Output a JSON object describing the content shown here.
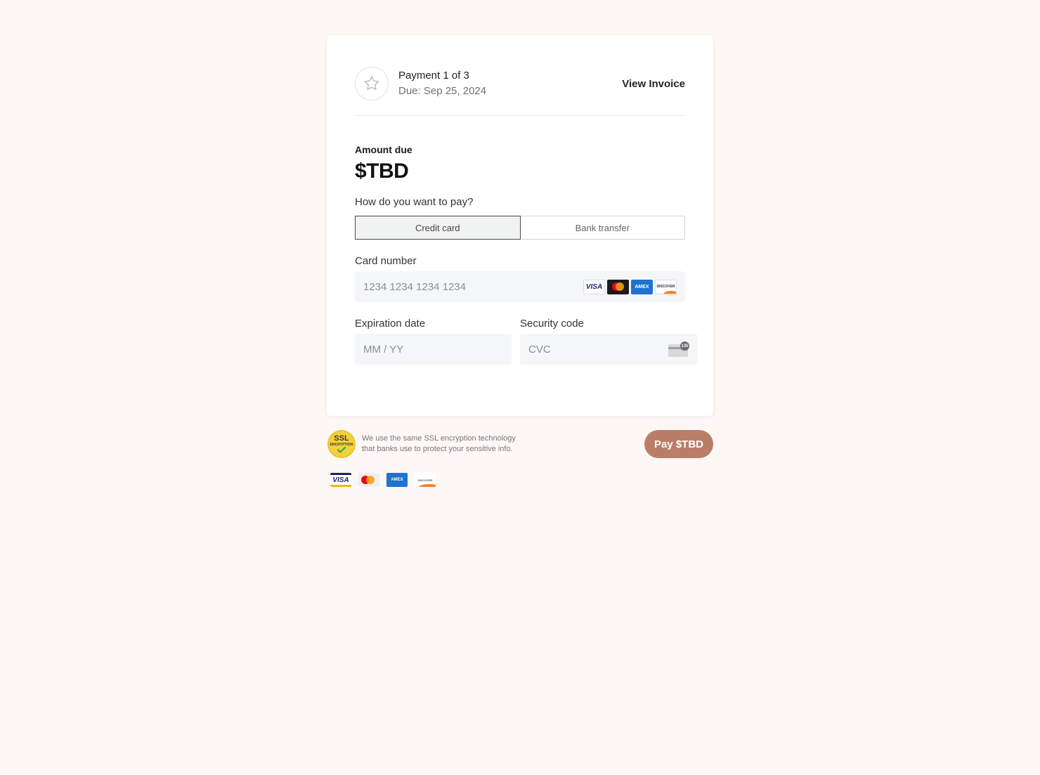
{
  "header": {
    "payment_title": "Payment 1 of 3",
    "due_date": "Due: Sep 25, 2024",
    "view_invoice": "View Invoice"
  },
  "amount": {
    "label": "Amount due",
    "value": "$TBD"
  },
  "payment_method": {
    "question": "How do you want to pay?",
    "options": [
      "Credit card",
      "Bank transfer"
    ],
    "selected": "Credit card"
  },
  "card_number": {
    "label": "Card number",
    "placeholder": "1234 1234 1234 1234",
    "brands": [
      "VISA",
      "mastercard",
      "AMEX",
      "DISCOVER"
    ]
  },
  "expiration": {
    "label": "Expiration date",
    "placeholder": "MM / YY"
  },
  "security": {
    "label": "Security code",
    "placeholder": "CVC",
    "icon_digits": "135"
  },
  "ssl": {
    "badge_big": "SSL",
    "badge_small": "ENCRYPTION",
    "line1": "We use the same SSL encryption technology",
    "line2": "that banks use to protect your sensitive info."
  },
  "pay_button": "Pay $TBD",
  "footer_brands": [
    "VISA",
    "mastercard",
    "AMEX",
    "DISCOVER"
  ],
  "colors": {
    "background": "#fdf8f5",
    "pay_button": "#b97e67",
    "visa_blue": "#1a1f71",
    "amex_blue": "#1f72cd",
    "mc_red": "#eb001b",
    "mc_orange": "#f79e1b",
    "ssl_yellow": "#f4d13a"
  }
}
